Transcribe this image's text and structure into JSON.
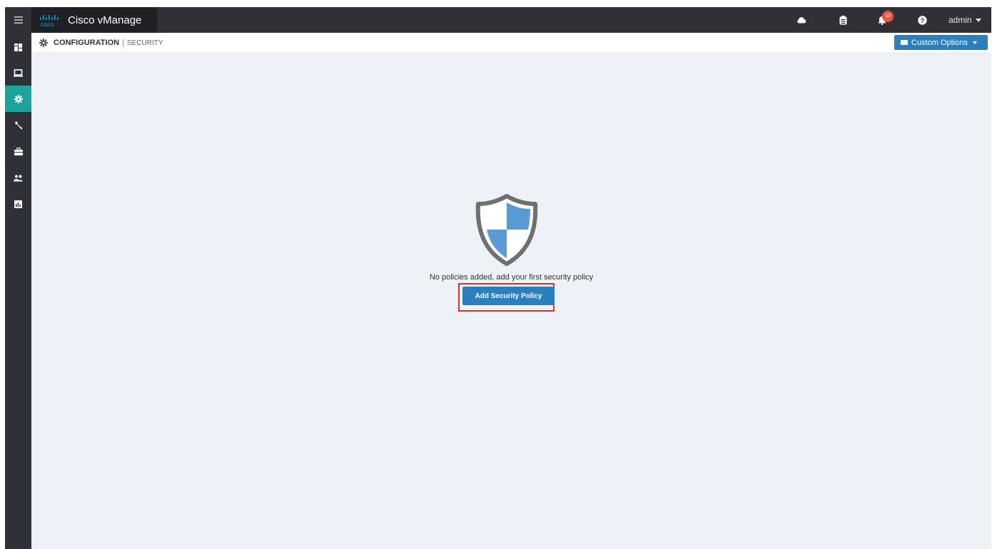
{
  "app": {
    "title": "Cisco vManage",
    "logo_text": "cisco"
  },
  "topbar": {
    "icons": [
      "cloud-icon",
      "clipboard-icon",
      "bell-icon",
      "help-icon"
    ],
    "alarm_count": "10",
    "user": "admin"
  },
  "sidebar": {
    "items": [
      {
        "name": "dashboard",
        "icon": "dashboard-icon",
        "active": false
      },
      {
        "name": "monitor",
        "icon": "monitor-icon",
        "active": false
      },
      {
        "name": "configuration",
        "icon": "gear-icon",
        "active": true
      },
      {
        "name": "tools",
        "icon": "wrench-icon",
        "active": false
      },
      {
        "name": "maintenance",
        "icon": "briefcase-icon",
        "active": false
      },
      {
        "name": "administration",
        "icon": "users-icon",
        "active": false
      },
      {
        "name": "analytics",
        "icon": "chart-icon",
        "active": false
      }
    ]
  },
  "header": {
    "section": "CONFIGURATION",
    "separator": "|",
    "page": "SECURITY",
    "custom_options_label": "Custom Options"
  },
  "empty_state": {
    "message": "No policies added, add your first security policy",
    "button_label": "Add Security Policy"
  },
  "colors": {
    "topbar": "#2f3136",
    "active_nav": "#1ba39c",
    "primary_button": "#2c7fbd",
    "highlight_border": "#d9342b",
    "background": "#eef1f6"
  }
}
